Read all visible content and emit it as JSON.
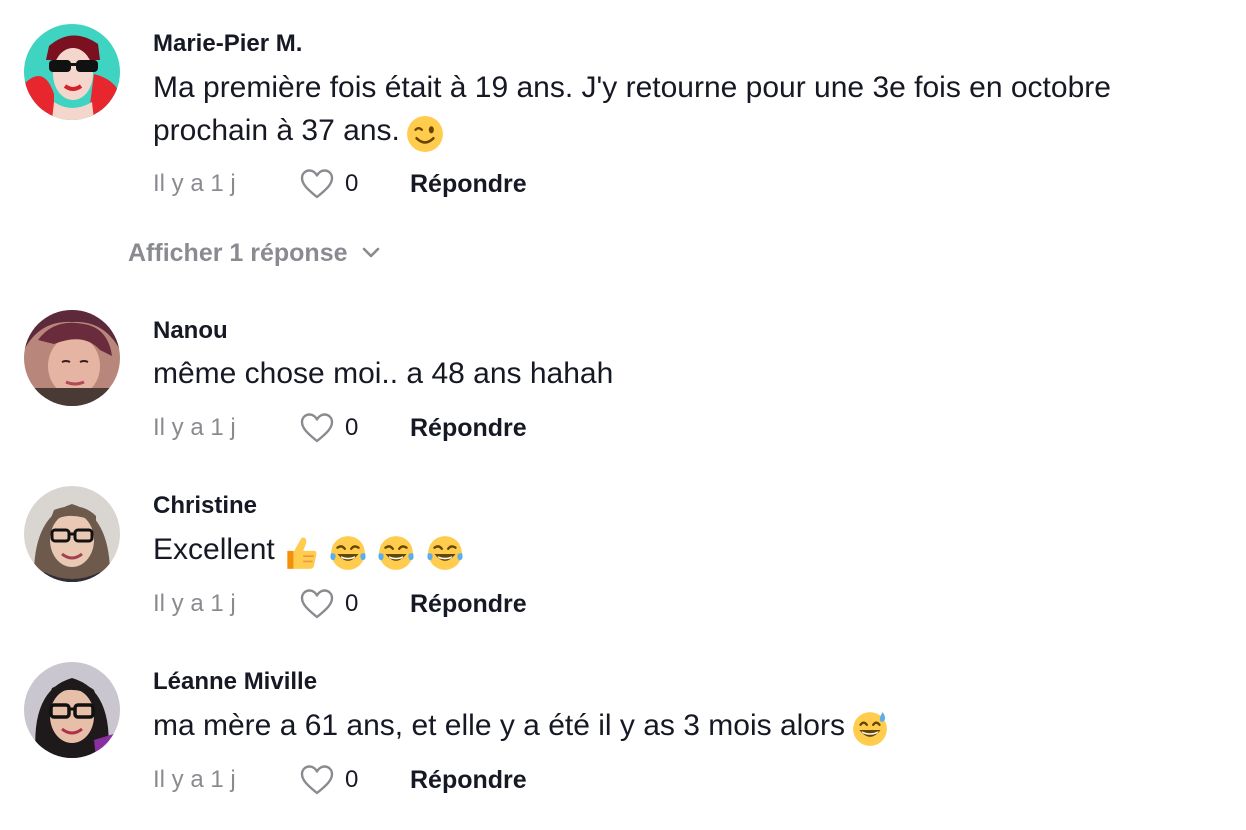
{
  "comments": [
    {
      "author": "Marie-Pier M.",
      "text": "Ma première fois était à 19 ans. J'y retourne pour une 3e fois en octobre prochain à 37 ans.",
      "emoji": [
        "winking-face"
      ],
      "time": "Il y a 1 j",
      "likes": "0",
      "reply_label": "Répondre"
    },
    {
      "author": "Nanou",
      "text": "même chose moi.. a 48 ans hahah",
      "emoji": [],
      "time": "Il y a 1 j",
      "likes": "0",
      "reply_label": "Répondre"
    },
    {
      "author": "Christine",
      "text": "Excellent",
      "emoji": [
        "thumbs-up",
        "tears-of-joy",
        "tears-of-joy",
        "tears-of-joy"
      ],
      "time": "Il y a 1 j",
      "likes": "0",
      "reply_label": "Répondre"
    },
    {
      "author": "Léanne Miville",
      "text": "ma mère a 61 ans, et elle y a été il y as 3 mois alors",
      "emoji": [
        "grinning-sweat"
      ],
      "time": "Il y a 1 j",
      "likes": "0",
      "reply_label": "Répondre"
    }
  ],
  "show_replies_label": "Afficher 1 réponse",
  "colors": {
    "text": "#161823",
    "muted": "#8a8b91",
    "emoji_yellow": "#ffcc4d"
  }
}
